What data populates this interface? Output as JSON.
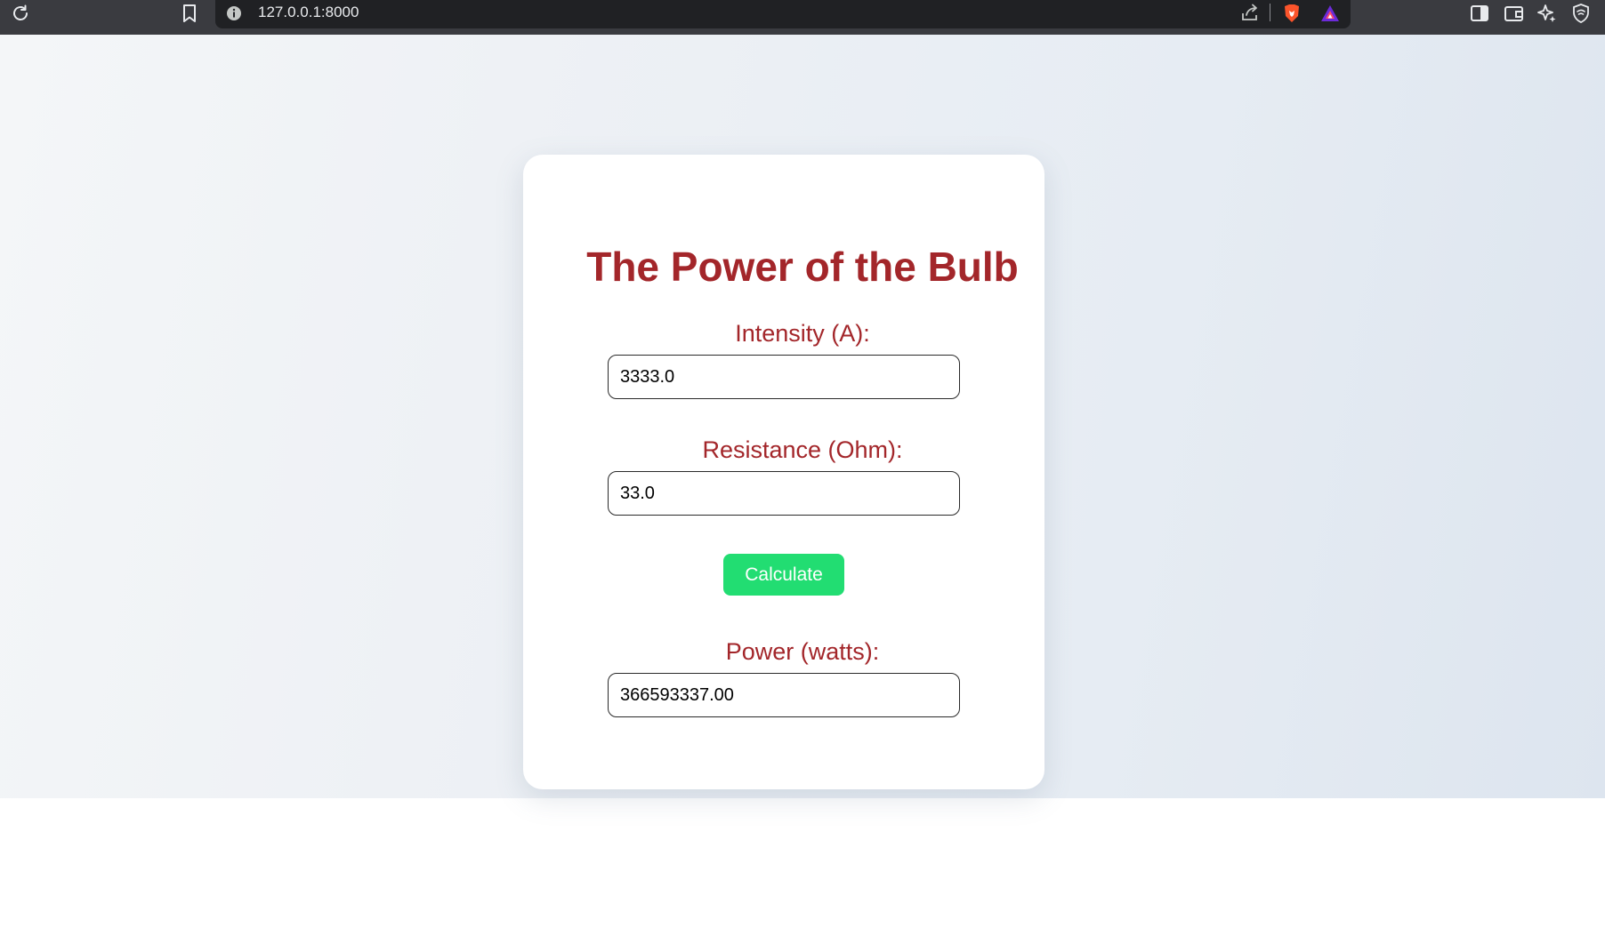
{
  "browser": {
    "url": "127.0.0.1:8000",
    "icons": [
      "reload-icon",
      "bookmark-icon",
      "site-info-icon",
      "share-icon",
      "brave-shields-icon",
      "brave-rewards-icon",
      "sidebar-icon",
      "wallet-icon",
      "leo-ai-icon",
      "vpn-icon"
    ]
  },
  "form": {
    "title": "The Power of the Bulb",
    "intensity_label": "Intensity (A):",
    "intensity_value": "3333.0",
    "resistance_label": "Resistance (Ohm):",
    "resistance_value": "33.0",
    "calculate_label": "Calculate",
    "power_label": "Power (watts):",
    "power_value": "366593337.00"
  },
  "colors": {
    "title": "#a3262a",
    "button": "#22dd72",
    "toolbar": "#202124"
  }
}
